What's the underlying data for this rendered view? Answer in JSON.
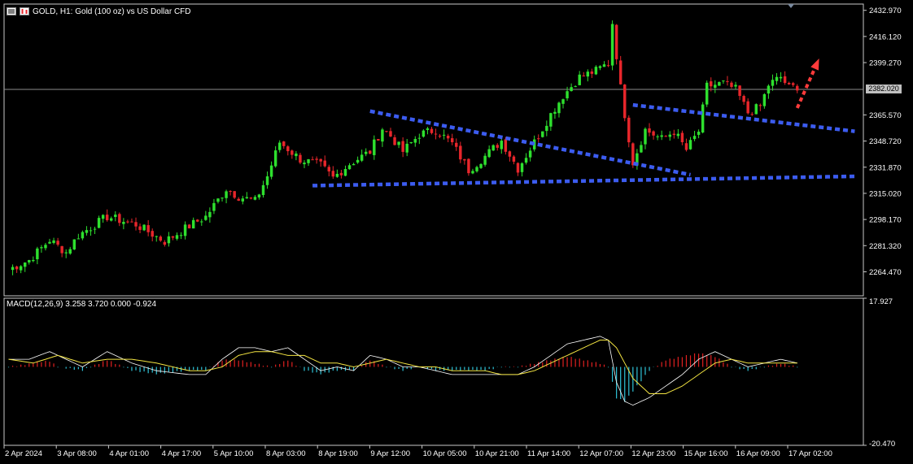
{
  "title": "GOLD, H1:  Gold (100 oz) vs US Dollar CFD",
  "icons": [
    "window-menu-icon",
    "chart-type-icon"
  ],
  "current_price": "2382.020",
  "macd_label": "MACD(12,26,9) 3.258 3.720 0.000 -0.924",
  "colors": {
    "bull": "#2ee02e",
    "bear": "#e8262b",
    "trend_lines": "#3c5cf0",
    "arrow": "#ff3b3b",
    "macd_pos": "#e02020",
    "macd_neg": "#2fc3d8",
    "signal": "#f4e542",
    "macd_line": "#ffffff"
  },
  "chart_data": [
    {
      "type": "candlestick",
      "ylim": [
        2249,
        2437
      ],
      "y_ticks": [
        "2432.970",
        "2416.120",
        "2399.270",
        "2382.020",
        "2365.570",
        "2348.720",
        "2331.870",
        "2315.020",
        "2298.170",
        "2281.320",
        "2264.470"
      ],
      "x_ticks": [
        "2 Apr 2024",
        "3 Apr 08:00",
        "4 Apr 01:00",
        "4 Apr 17:00",
        "5 Apr 10:00",
        "8 Apr 03:00",
        "8 Apr 19:00",
        "9 Apr 12:00",
        "10 Apr 05:00",
        "10 Apr 21:00",
        "11 Apr 14:00",
        "12 Apr 07:00",
        "12 Apr 23:00",
        "15 Apr 16:00",
        "16 Apr 09:00",
        "17 Apr 02:00"
      ],
      "close_path": [
        [
          0,
          2266
        ],
        [
          5,
          2272
        ],
        [
          10,
          2285
        ],
        [
          14,
          2277
        ],
        [
          17,
          2288
        ],
        [
          24,
          2300
        ],
        [
          31,
          2295
        ],
        [
          38,
          2284
        ],
        [
          44,
          2294
        ],
        [
          48,
          2300
        ],
        [
          53,
          2318
        ],
        [
          56,
          2313
        ],
        [
          60,
          2310
        ],
        [
          63,
          2326
        ],
        [
          66,
          2348
        ],
        [
          71,
          2337
        ],
        [
          76,
          2333
        ],
        [
          79,
          2325
        ],
        [
          83,
          2334
        ],
        [
          88,
          2342
        ],
        [
          91,
          2357
        ],
        [
          93,
          2352
        ],
        [
          96,
          2342
        ],
        [
          100,
          2353
        ],
        [
          104,
          2356
        ],
        [
          108,
          2347
        ],
        [
          112,
          2330
        ],
        [
          116,
          2339
        ],
        [
          120,
          2349
        ],
        [
          124,
          2331
        ],
        [
          128,
          2348
        ],
        [
          132,
          2366
        ],
        [
          135,
          2378
        ],
        [
          139,
          2390
        ],
        [
          143,
          2394
        ],
        [
          146,
          2399
        ],
        [
          147,
          2425
        ],
        [
          149,
          2383
        ],
        [
          150,
          2366
        ],
        [
          152,
          2335
        ],
        [
          155,
          2356
        ],
        [
          159,
          2350
        ],
        [
          162,
          2355
        ],
        [
          165,
          2343
        ],
        [
          168,
          2355
        ],
        [
          170,
          2384
        ],
        [
          174,
          2386
        ],
        [
          177,
          2382
        ],
        [
          180,
          2367
        ],
        [
          183,
          2371
        ],
        [
          185,
          2385
        ],
        [
          188,
          2390
        ],
        [
          190,
          2383
        ],
        [
          192,
          2384
        ]
      ],
      "annotations": [
        {
          "type": "trendline",
          "from": [
            88,
            2368
          ],
          "to": [
            166,
            2327
          ]
        },
        {
          "type": "trendline",
          "from": [
            74,
            2320
          ],
          "to": [
            206,
            2326
          ]
        },
        {
          "type": "trendline",
          "from": [
            152,
            2372
          ],
          "to": [
            206,
            2355
          ]
        },
        {
          "type": "arrow",
          "from": [
            192,
            2370
          ],
          "to": [
            197,
            2400
          ]
        }
      ]
    },
    {
      "type": "histogram+lines",
      "title": "MACD(12,26,9) 3.258 3.720 0.000 -0.924",
      "ylim": [
        -20.47,
        17.927
      ],
      "y_ticks": [
        "17.927",
        "-20.470"
      ],
      "macd_path": [
        [
          0,
          2
        ],
        [
          5,
          2
        ],
        [
          10,
          4
        ],
        [
          14,
          2
        ],
        [
          18,
          0
        ],
        [
          24,
          4
        ],
        [
          30,
          1
        ],
        [
          36,
          -1
        ],
        [
          44,
          -2
        ],
        [
          48,
          -2
        ],
        [
          52,
          2
        ],
        [
          56,
          5
        ],
        [
          60,
          5
        ],
        [
          64,
          4
        ],
        [
          68,
          5
        ],
        [
          72,
          2
        ],
        [
          76,
          -1
        ],
        [
          80,
          0
        ],
        [
          84,
          -1
        ],
        [
          88,
          3
        ],
        [
          92,
          2
        ],
        [
          96,
          0
        ],
        [
          100,
          0
        ],
        [
          104,
          -1
        ],
        [
          108,
          -2
        ],
        [
          112,
          -2
        ],
        [
          116,
          -2
        ],
        [
          120,
          -2
        ],
        [
          124,
          -2
        ],
        [
          128,
          0
        ],
        [
          132,
          3
        ],
        [
          136,
          6
        ],
        [
          140,
          7
        ],
        [
          144,
          8
        ],
        [
          146,
          7
        ],
        [
          148,
          -4
        ],
        [
          150,
          -9
        ],
        [
          152,
          -10
        ],
        [
          156,
          -8
        ],
        [
          160,
          -5
        ],
        [
          164,
          -2
        ],
        [
          168,
          2
        ],
        [
          172,
          4
        ],
        [
          176,
          2
        ],
        [
          180,
          0
        ],
        [
          184,
          1
        ],
        [
          188,
          2
        ],
        [
          192,
          1
        ]
      ],
      "signal_path": [
        [
          0,
          2
        ],
        [
          6,
          1
        ],
        [
          12,
          3
        ],
        [
          18,
          1
        ],
        [
          24,
          2
        ],
        [
          30,
          2
        ],
        [
          36,
          1
        ],
        [
          44,
          -1
        ],
        [
          48,
          -1
        ],
        [
          52,
          0
        ],
        [
          56,
          3
        ],
        [
          60,
          4
        ],
        [
          64,
          4
        ],
        [
          68,
          3
        ],
        [
          72,
          3
        ],
        [
          76,
          1
        ],
        [
          80,
          1
        ],
        [
          84,
          0
        ],
        [
          88,
          1
        ],
        [
          92,
          2
        ],
        [
          96,
          1
        ],
        [
          100,
          0
        ],
        [
          104,
          0
        ],
        [
          108,
          -1
        ],
        [
          112,
          -1
        ],
        [
          116,
          -1
        ],
        [
          120,
          -2
        ],
        [
          124,
          -2
        ],
        [
          128,
          -1
        ],
        [
          132,
          1
        ],
        [
          136,
          3
        ],
        [
          140,
          5
        ],
        [
          144,
          7
        ],
        [
          146,
          7
        ],
        [
          148,
          5
        ],
        [
          150,
          1
        ],
        [
          152,
          -3
        ],
        [
          156,
          -7
        ],
        [
          160,
          -7
        ],
        [
          164,
          -5
        ],
        [
          168,
          -2
        ],
        [
          172,
          1
        ],
        [
          176,
          2
        ],
        [
          180,
          1
        ],
        [
          184,
          1
        ],
        [
          188,
          1
        ],
        [
          192,
          1
        ]
      ]
    }
  ]
}
